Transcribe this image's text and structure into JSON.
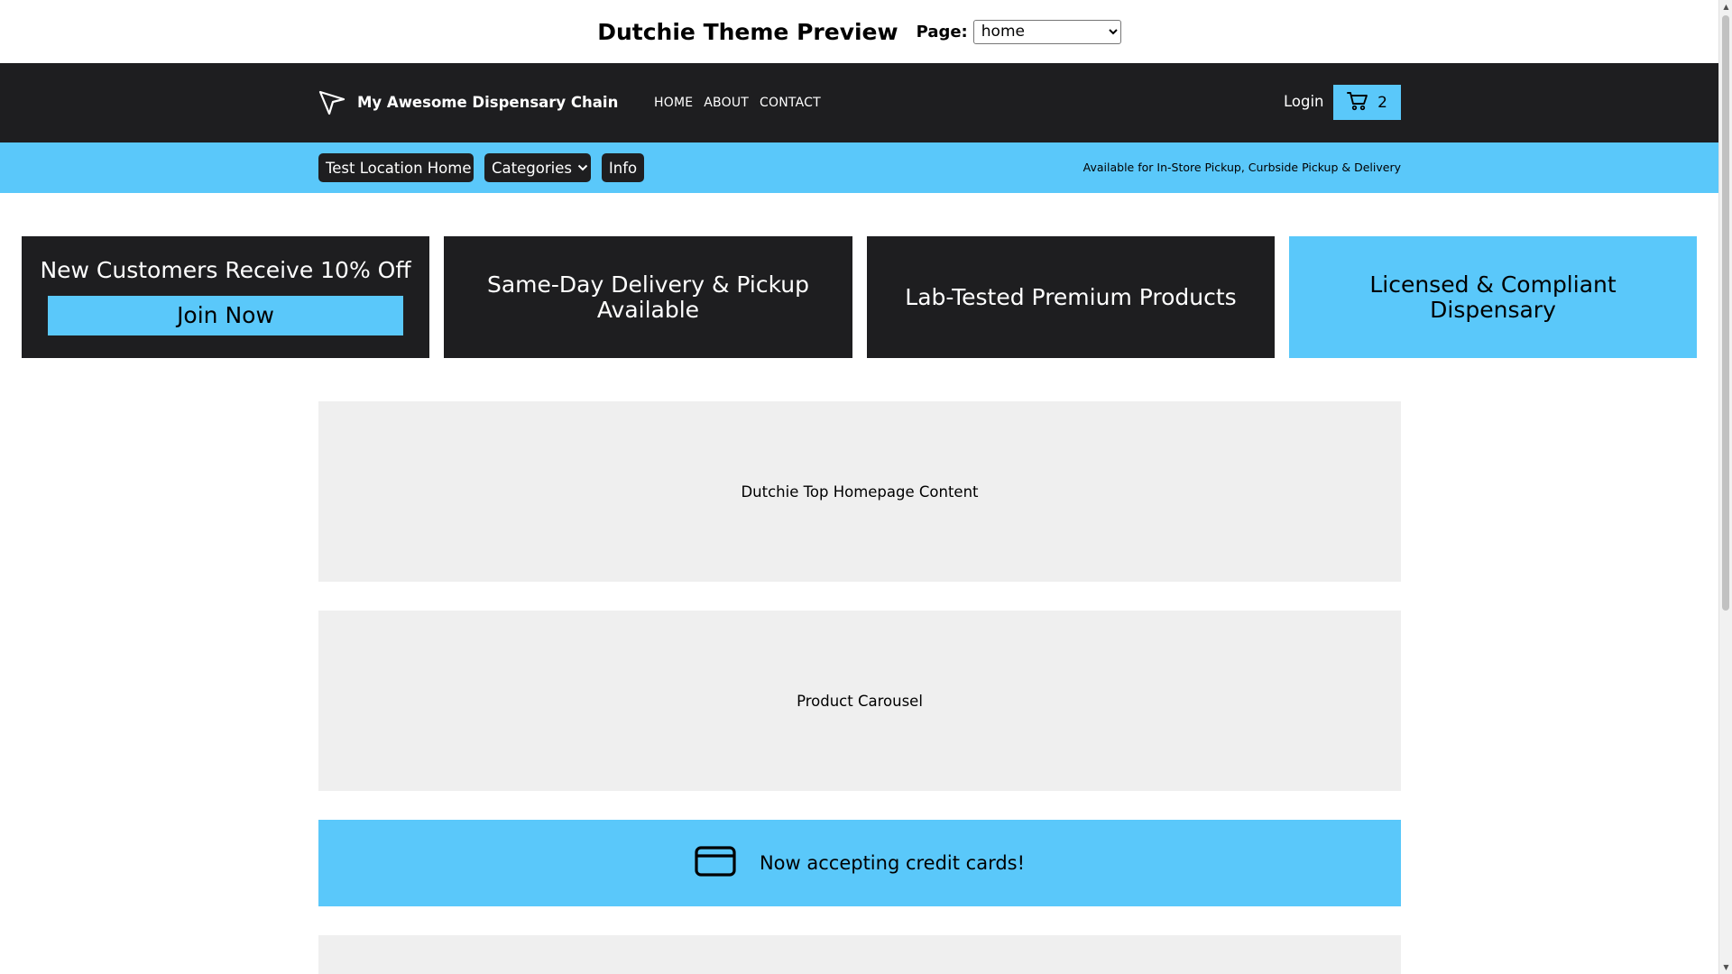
{
  "preview": {
    "title": "Dutchie Theme Preview",
    "page_label": "Page:",
    "page_selected": "home"
  },
  "header": {
    "brand": "My Awesome Dispensary Chain",
    "nav": [
      "HOME",
      "ABOUT",
      "CONTACT"
    ],
    "login": "Login",
    "cart_count": "2"
  },
  "location_bar": {
    "home": "Test Location Home",
    "categories": "Categories",
    "info": "Info",
    "availability": "Available for In-Store Pickup, Curbside Pickup & Delivery"
  },
  "promos": {
    "p1": "New Customers Receive 10% Off",
    "join": "Join Now",
    "p2": "Same-Day Delivery & Pickup Available",
    "p3": "Lab-Tested Premium Products",
    "p4": "Licensed & Compliant Dispensary"
  },
  "content": {
    "top": "Dutchie Top Homepage Content",
    "carousel": "Product Carousel",
    "credit": "Now accepting credit cards!"
  },
  "colors": {
    "accent": "#5ac8fa",
    "dark": "#1e1e20",
    "placeholder": "#efefef"
  },
  "icons": [
    "navigation-arrow-icon",
    "cart-icon",
    "chevron-down-icon",
    "credit-card-icon"
  ]
}
